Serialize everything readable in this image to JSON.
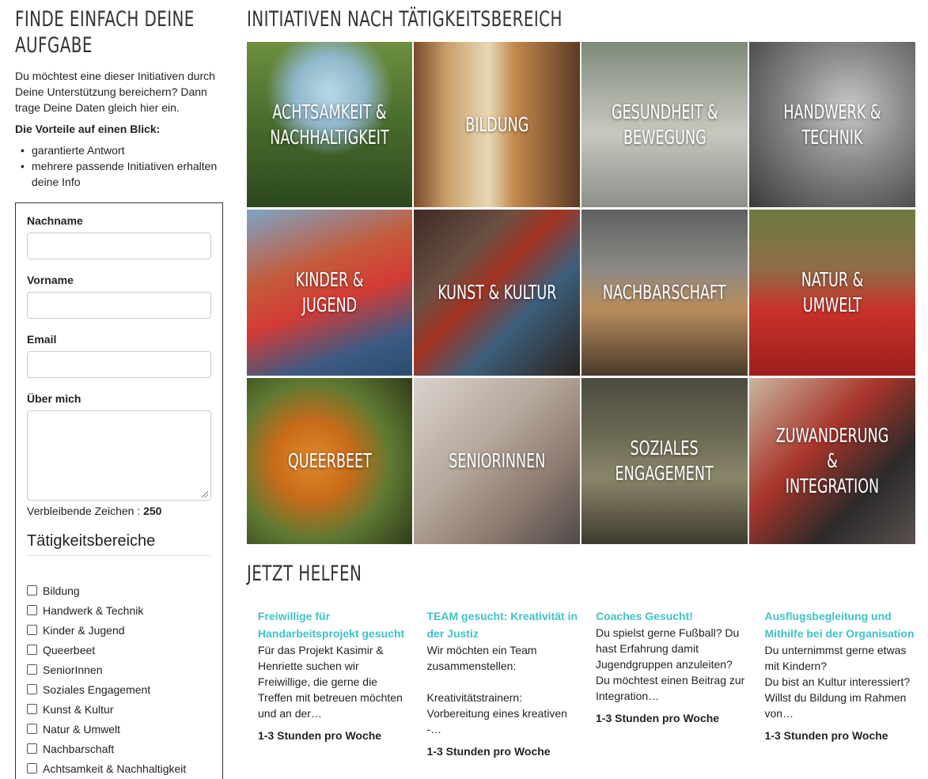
{
  "left": {
    "title": "FINDE EINFACH DEINE AUFGABE",
    "intro": "Du möchtest eine dieser Initiativen durch Deine Unterstützung bereichern? Dann trage Deine Daten gleich hier ein.",
    "vorteile_title": "Die Vorteile auf einen Blick:",
    "vorteile": [
      "garantierte Antwort",
      "mehrere passende Initiativen erhalten deine Info"
    ]
  },
  "form": {
    "nachname_label": "Nachname",
    "vorname_label": "Vorname",
    "email_label": "Email",
    "about_label": "Über mich",
    "remaining_label": "Verbleibende Zeichen :",
    "remaining_value": "250",
    "categories_title": "Tätigkeitsbereiche",
    "categories": [
      "Bildung",
      "Handwerk & Technik",
      "Kinder & Jugend",
      "Queerbeet",
      "SeniorInnen",
      "Soziales Engagement",
      "Kunst & Kultur",
      "Natur & Umwelt",
      "Nachbarschaft",
      "Achtsamkeit & Nachhaltigkeit"
    ]
  },
  "main": {
    "title": "INITIATIVEN NACH TÄTIGKEITSBEREICH",
    "tiles": [
      "ACHTSAMKEIT &\nNACHHALTIGKEIT",
      "BILDUNG",
      "GESUNDHEIT &\nBEWEGUNG",
      "HANDWERK &\nTECHNIK",
      "KINDER & JUGEND",
      "KUNST & KULTUR",
      "NACHBARSCHAFT",
      "NATUR & UMWELT",
      "QUEERBEET",
      "SENIORINNEN",
      "SOZIALES\nENGAGEMENT",
      "ZUWANDERUNG &\nINTEGRATION"
    ],
    "help_title": "JETZT HELFEN",
    "cards": [
      {
        "title": "Freiwillige für Handarbeitsprojekt gesucht",
        "text": "Für das Projekt Kasimir & Henriette suchen wir Freiwillige, die gerne die Treffen mit betreuen möchten und an der…",
        "hours": "1-3 Stunden pro Woche"
      },
      {
        "title": "TEAM gesucht: Kreativität in der Justiz",
        "text": "Wir möchten ein Team zusammenstellen:\n\nKreativitätstrainern: Vorbereitung eines kreativen -…",
        "hours": "1-3 Stunden pro Woche"
      },
      {
        "title": "Coaches Gesucht!",
        "text": "Du spielst gerne Fußball? Du hast Erfahrung damit Jugendgruppen anzuleiten? Du möchtest einen Beitrag zur Integration…",
        "hours": "1-3 Stunden pro Woche"
      },
      {
        "title": "Ausflugsbegleitung und Mithilfe bei der Organisation",
        "text": "Du unternimmst gerne etwas mit Kindern?\nDu bist an Kultur interessiert?\nWillst du Bildung im Rahmen von…",
        "hours": "1-3 Stunden pro Woche"
      }
    ]
  }
}
